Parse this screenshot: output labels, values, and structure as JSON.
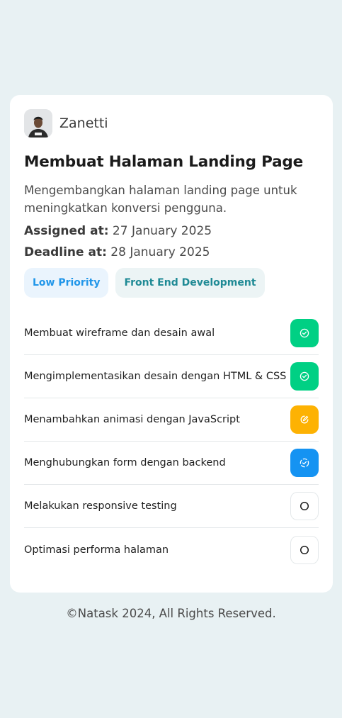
{
  "user": {
    "name": "Zanetti"
  },
  "task": {
    "title": "Membuat Halaman Landing Page",
    "description": "Mengembangkan halaman landing page untuk meningkatkan konversi pengguna.",
    "assigned_label": "Assigned at:",
    "assigned_value": "27 January 2025",
    "deadline_label": "Deadline at:",
    "deadline_value": "28 January 2025"
  },
  "tags": {
    "priority": "Low Priority",
    "category": "Front End Development"
  },
  "subtasks": [
    {
      "label": "Membuat wireframe dan desain awal",
      "status": "done",
      "icon": "check-circle-icon"
    },
    {
      "label": "Mengimplementasikan desain dengan HTML & CSS",
      "status": "done",
      "icon": "check-circle-icon"
    },
    {
      "label": "Menambahkan animasi dengan JavaScript",
      "status": "edit",
      "icon": "pencil-icon"
    },
    {
      "label": "Menghubungkan form dengan backend",
      "status": "progress",
      "icon": "dashed-check-circle-icon"
    },
    {
      "label": "Melakukan responsive testing",
      "status": "todo",
      "icon": "empty-circle-icon"
    },
    {
      "label": "Optimasi performa halaman",
      "status": "todo",
      "icon": "empty-circle-icon"
    }
  ],
  "colors": {
    "done": "#00d084",
    "edit": "#fdb203",
    "progress": "#1593f2",
    "priority_tag": "#2196e9",
    "category_tag": "#1f8a95"
  },
  "footer": {
    "text": "©Natask 2024, All Rights Reserved."
  }
}
